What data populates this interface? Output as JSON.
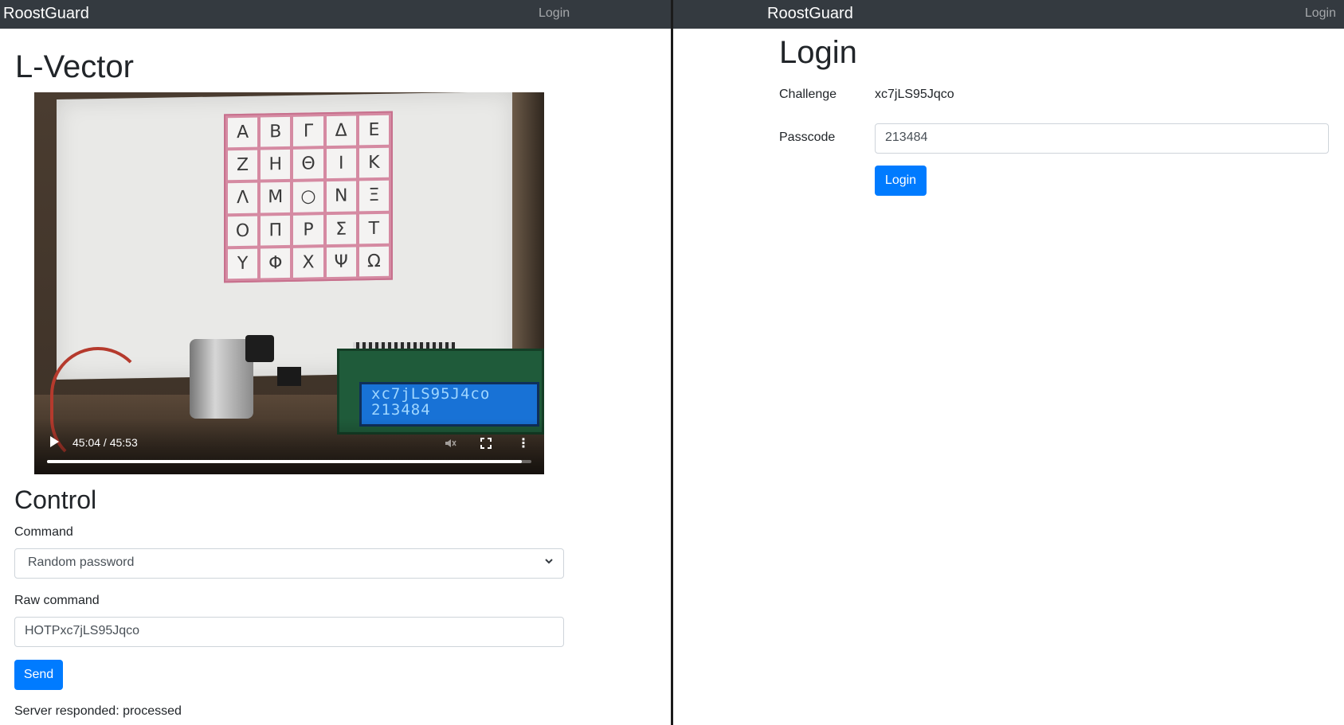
{
  "left": {
    "navbar": {
      "brand": "RoostGuard",
      "link": "Login"
    },
    "title": "L-Vector",
    "video": {
      "grid_letters": [
        "Α",
        "Β",
        "Γ",
        "Δ",
        "Ε",
        "Ζ",
        "Η",
        "Θ",
        "Ι",
        "Κ",
        "Λ",
        "Μ",
        "○",
        "Ν",
        "Ξ",
        "Ο",
        "Π",
        "Ρ",
        "Σ",
        "Τ",
        "Υ",
        "Φ",
        "Χ",
        "Ψ",
        "Ω"
      ],
      "lcd": {
        "line1": "xc7jLS95J4co",
        "line2": "213484"
      },
      "time": "45:04 / 45:53",
      "progress": 0.98
    },
    "control": {
      "heading": "Control",
      "command_label": "Command",
      "command_value": "Random password",
      "raw_label": "Raw command",
      "raw_value": "HOTPxc7jLS95Jqco",
      "send_label": "Send",
      "server_response": "Server responded: processed"
    }
  },
  "right": {
    "navbar": {
      "brand": "RoostGuard",
      "link": "Login"
    },
    "title": "Login",
    "challenge_label": "Challenge",
    "challenge_value": "xc7jLS95Jqco",
    "passcode_label": "Passcode",
    "passcode_value": "213484",
    "login_button": "Login"
  }
}
